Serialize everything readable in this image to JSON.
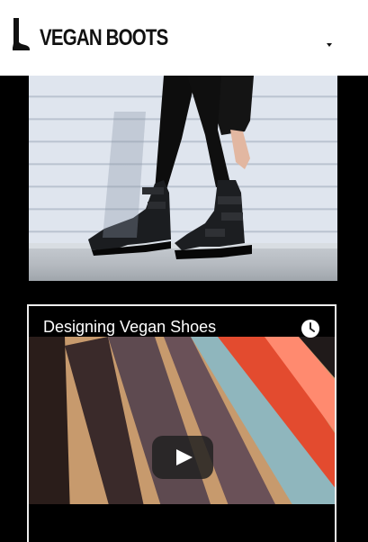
{
  "header": {
    "brand": "VEGAN BOOTS",
    "logo_icon": "boot-icon",
    "menu_icon": "caret-down-icon"
  },
  "hero_image": {
    "subject": "boots-photo"
  },
  "video": {
    "title": "Designing Vegan Shoes",
    "clock_icon": "clock-icon",
    "play_icon": "play-icon"
  },
  "colors": {
    "header_bg": "#ffffff",
    "page_bg": "#000000",
    "play_button": "#212121"
  }
}
